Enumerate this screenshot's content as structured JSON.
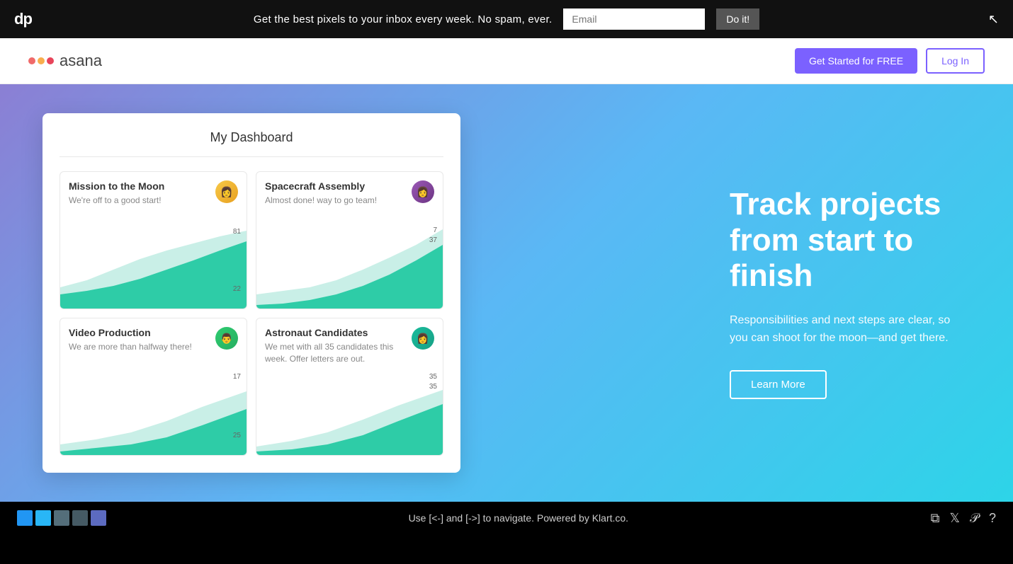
{
  "topbar": {
    "logo": "dp",
    "promo_text": "Get the best pixels to your inbox every week. No spam, ever.",
    "email_placeholder": "Email",
    "cta_button": "Do it!"
  },
  "asana_header": {
    "logo_name": "asana",
    "cta_button": "Get Started for FREE",
    "login_button": "Log In"
  },
  "hero": {
    "heading": "Track projects from start to finish",
    "body": "Responsibilities and next steps are clear, so you can shoot for the moon—and get there.",
    "learn_more": "Learn More"
  },
  "dashboard": {
    "title": "My Dashboard",
    "projects": [
      {
        "title": "Mission to the Moon",
        "desc": "We're off to a good start!",
        "chart_top": "81",
        "chart_bottom": "22"
      },
      {
        "title": "Spacecraft Assembly",
        "desc": "Almost done! way to go team!",
        "chart_top": "7",
        "chart_mid": "37",
        "chart_bottom": ""
      },
      {
        "title": "Video Production",
        "desc": "We are more than halfway there!",
        "chart_top": "17",
        "chart_bottom": "25"
      },
      {
        "title": "Astronaut Candidates",
        "desc": "We met with all 35 candidates this week. Offer letters are out.",
        "chart_top": "35",
        "chart_bottom": "35"
      }
    ]
  },
  "bottom": {
    "nav_text": "Use [<-] and [->] to navigate. Powered by Klart.co.",
    "swatches": [
      "#2196F3",
      "#29B6F6",
      "#546E7A",
      "#455A64",
      "#5C6BC0"
    ]
  }
}
